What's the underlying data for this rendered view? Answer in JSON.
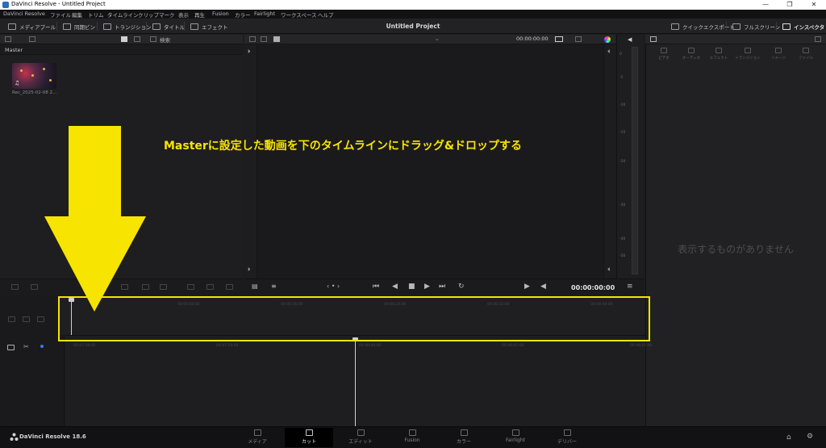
{
  "window": {
    "title": "DaVinci Resolve - Untitled Project",
    "controls": [
      "—",
      "❐",
      "✕"
    ]
  },
  "menu": [
    "DaVinci Resolve",
    "ファイル",
    "編集",
    "トリム",
    "タイムライン",
    "クリップ",
    "マーク",
    "表示",
    "再生",
    "Fusion",
    "カラー",
    "Fairlight",
    "ワークスペース",
    "ヘルプ"
  ],
  "toolbar": {
    "media_pool": "メディアプール",
    "sync_bin": "同期ビン",
    "transitions": "トランジション",
    "titles": "タイトル",
    "effects": "エフェクト",
    "project_title": "Untitled Project",
    "quick_export": "クイックエクスポート",
    "fullscreen": "フルスクリーン",
    "inspector": "インスペクタ"
  },
  "media_pool": {
    "search_label": "検索",
    "bin": "Master",
    "clip_name": "Rec_2025-02-08 2...",
    "clip_icon": "♫"
  },
  "viewer": {
    "timecode": "00:00:00:00"
  },
  "audio_meter": {
    "labels": [
      "0",
      "-5",
      "-10",
      "-15",
      "-20",
      "-30",
      "-40",
      "-50"
    ]
  },
  "inspector": {
    "tabs": [
      "ビデオ",
      "オーディオ",
      "エフェクト",
      "トランジション",
      "イメージ",
      "ファイル"
    ],
    "empty_message": "表示するものがありません"
  },
  "transport": {
    "timecode": "00:00:00:00",
    "icons": [
      "skip-to-start-icon",
      "rewind-icon",
      "stop-icon",
      "play-icon",
      "skip-to-end-icon",
      "loop-icon"
    ]
  },
  "timeline": {
    "upper_ruler": [
      "00:00:00:00",
      "00:00:08:00",
      "00:00:16:00",
      "00:00:24:00",
      "00:00:32:00",
      "00:00:40:00"
    ],
    "lower_ruler": [
      "00:47:58:00",
      "00:47:59:00",
      "00:48:00:00",
      "00:48:01:00",
      "00:48:02:00"
    ]
  },
  "annotation": {
    "text": "Masterに設定した動画を下のタイムラインにドラッグ&ドロップする",
    "color": "#f7e400"
  },
  "pagebar": {
    "brand": "DaVinci Resolve 18.6",
    "pages": [
      "メディア",
      "カット",
      "エディット",
      "Fusion",
      "カラー",
      "Fairlight",
      "デリバー"
    ],
    "active_page": "カット"
  }
}
